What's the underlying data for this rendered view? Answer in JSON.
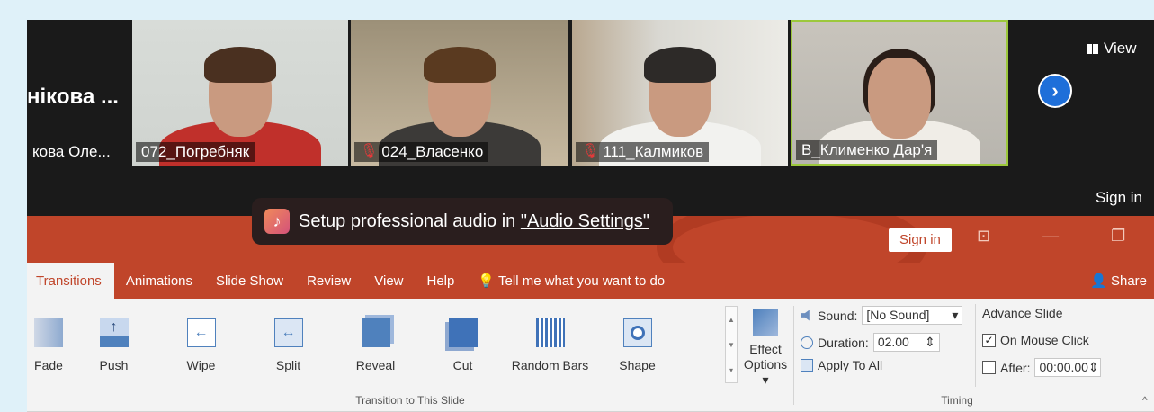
{
  "zoom": {
    "participants": [
      {
        "big_name": "нікова ...",
        "tag": "кова Оле...",
        "muted": false
      },
      {
        "tag": "072_Погребняк",
        "muted": false
      },
      {
        "tag": "024_Власенко",
        "muted": true
      },
      {
        "tag": "111_Калмиков",
        "muted": true
      },
      {
        "tag": "В_Клименко Дар'я",
        "muted": false
      }
    ],
    "view_label": "View",
    "sign_in_label": "Sign in",
    "next_icon": "chevron-right-icon"
  },
  "toast": {
    "prefix": "Setup professional audio in ",
    "link": "\"Audio Settings\""
  },
  "ppt": {
    "sign_in": "Sign in",
    "window_controls": [
      "⊡",
      "—",
      "❐",
      "✕"
    ],
    "tabs": [
      "Transitions",
      "Animations",
      "Slide Show",
      "Review",
      "View",
      "Help",
      "Tell me what you want to do"
    ],
    "share": "Share",
    "active_tab": "Transitions",
    "transitions": [
      "Fade",
      "Push",
      "Wipe",
      "Split",
      "Reveal",
      "Cut",
      "Random Bars",
      "Shape"
    ],
    "effect_options": "Effect\nOptions ▾",
    "group_transition": "Transition to This Slide",
    "timing": {
      "sound_label": "Sound:",
      "sound_value": "[No Sound]",
      "duration_label": "Duration:",
      "duration_value": "02.00",
      "apply_all": "Apply To All",
      "advance_title": "Advance Slide",
      "on_mouse_click": "On Mouse Click",
      "on_mouse_click_checked": true,
      "after_label": "After:",
      "after_value": "00:00.00",
      "after_checked": false
    },
    "group_timing": "Timing",
    "accent": "#c0452a"
  }
}
